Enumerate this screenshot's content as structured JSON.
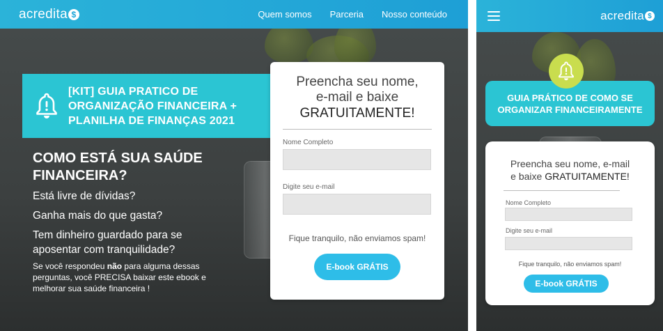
{
  "desktop": {
    "logo": "acredita",
    "logo_mark": "$",
    "nav": [
      "Quem somos",
      "Parceria",
      "Nosso conteúdo"
    ],
    "banner_lines": [
      "[KIT] GUIA PRATICO DE",
      "ORGANIZAÇÃO FINANCEIRA +",
      "PLANILHA DE FINANÇAS 2021"
    ],
    "headline_lines": [
      "COMO ESTÁ SUA SAÚDE",
      "FINANCEIRA?"
    ],
    "q1": "Está livre de dívidas?",
    "q2": "Ganha mais do que gasta?",
    "q3_lines": [
      "Tem dinheiro guardado para se",
      "aposentar com tranquilidade?"
    ],
    "small_a": "Se você respondeu ",
    "small_b": "não",
    "small_c": " para alguma dessas perguntas, você PRECISA baixar este ebook e melhorar sua saúde financeira !",
    "form": {
      "title_1": "Preencha seu nome,",
      "title_2": "e-mail e baixe",
      "title_3": "GRATUITAMENTE!",
      "name_label": "Nome Completo",
      "email_label": "Digite seu e-mail",
      "spam": "Fique tranquilo, não enviamos spam!",
      "button": "E-book GRÁTIS"
    }
  },
  "mobile": {
    "logo": "acredita",
    "logo_mark": "$",
    "banner_lines": [
      "GUIA PRÁTICO DE COMO SE",
      "ORGANIZAR FINANCEIRAMENTE"
    ],
    "form": {
      "title_1": "Preencha seu nome, e-mail",
      "title_2a": "e baixe ",
      "title_2b": "GRATUITAMENTE!",
      "name_label": "Nome Completo",
      "email_label": "Digite seu e-mail",
      "spam": "Fique tranquilo, não enviamos spam!",
      "button": "E-book GRÁTIS"
    }
  },
  "colors": {
    "nav": "#1e9fd6",
    "banner": "#2bc5d3",
    "button": "#2ebde8",
    "bell_circle": "#c9dd4e"
  }
}
